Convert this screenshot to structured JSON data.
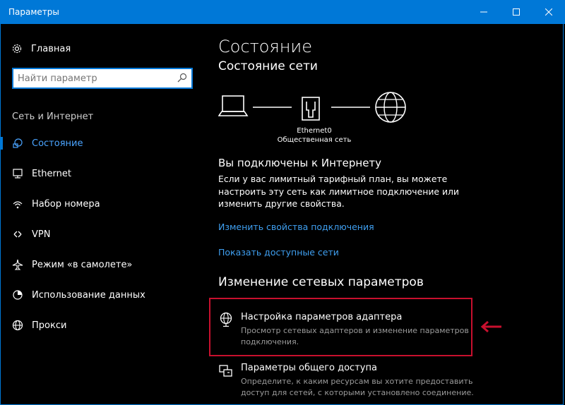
{
  "window": {
    "title": "Параметры",
    "accent_color": "#0078d7"
  },
  "sidebar": {
    "home_label": "Главная",
    "search_placeholder": "Найти параметр",
    "section_label": "Сеть и Интернет",
    "items": [
      {
        "label": "Состояние",
        "icon": "status-icon",
        "active": true
      },
      {
        "label": "Ethernet",
        "icon": "ethernet-icon",
        "active": false
      },
      {
        "label": "Набор номера",
        "icon": "dialup-icon",
        "active": false
      },
      {
        "label": "VPN",
        "icon": "vpn-icon",
        "active": false
      },
      {
        "label": "Режим «в самолете»",
        "icon": "airplane-icon",
        "active": false
      },
      {
        "label": "Использование данных",
        "icon": "data-usage-icon",
        "active": false
      },
      {
        "label": "Прокси",
        "icon": "globe-icon",
        "active": false
      }
    ]
  },
  "main": {
    "page_title": "Состояние",
    "network_status_heading": "Состояние сети",
    "adapter_name": "Ethernet0",
    "network_type": "Общественная сеть",
    "connected_heading": "Вы подключены к Интернету",
    "connected_description": "Если у вас лимитный тарифный план, вы можете настроить эту сеть как лимитное подключение или изменить другие свойства.",
    "link_change_properties": "Изменить свойства подключения",
    "link_show_networks": "Показать доступные сети",
    "change_settings_heading": "Изменение сетевых параметров",
    "settings": [
      {
        "title": "Настройка параметров адаптера",
        "description": "Просмотр сетевых адаптеров и изменение параметров подключения.",
        "icon": "adapter-globe-icon"
      },
      {
        "title": "Параметры общего доступа",
        "description": "Определите, к каким ресурсам вы хотите предоставить доступ для сетей, с которыми установлено соединение.",
        "icon": "sharing-icon"
      }
    ],
    "highlight_color": "#c8102e"
  }
}
